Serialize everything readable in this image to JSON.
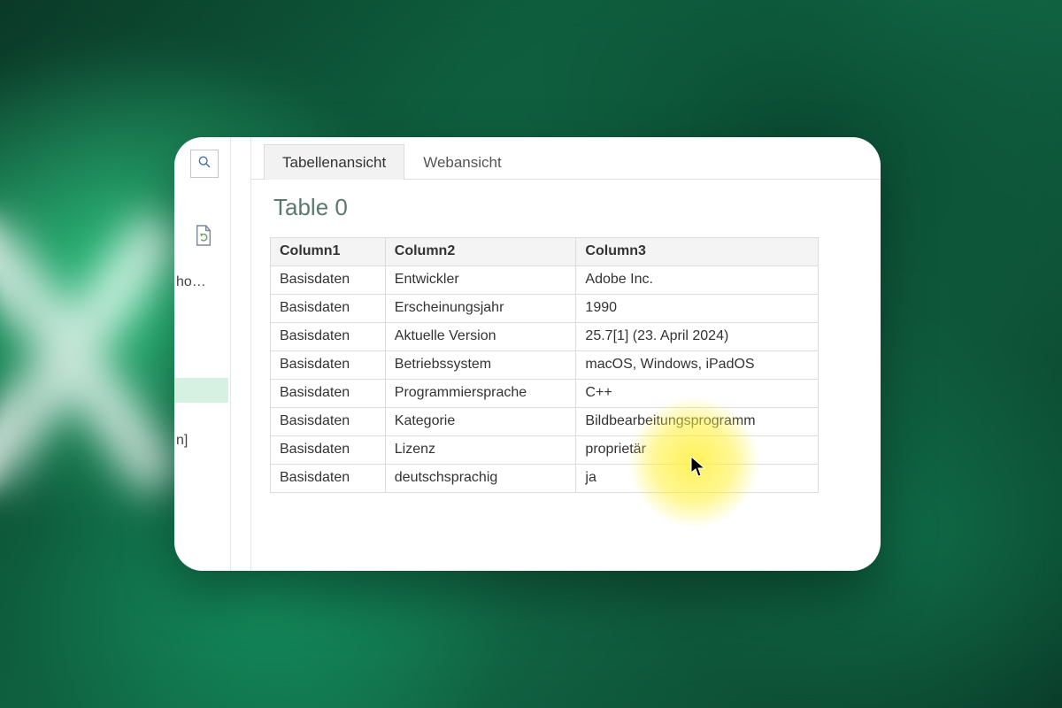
{
  "sidebar": {
    "search_icon_label": "Suchen",
    "text_fragment_1": "ho…",
    "text_fragment_2": "n]"
  },
  "tabs": {
    "table_view": "Tabellenansicht",
    "web_view": "Webansicht"
  },
  "table": {
    "title": "Table 0",
    "headers": {
      "c1": "Column1",
      "c2": "Column2",
      "c3": "Column3"
    },
    "rows": [
      {
        "c1": "Basisdaten",
        "c2": "Entwickler",
        "c3": "Adobe Inc."
      },
      {
        "c1": "Basisdaten",
        "c2": "Erscheinungsjahr",
        "c3": "1990"
      },
      {
        "c1": "Basisdaten",
        "c2": "Aktuelle Version",
        "c3": "25.7[1] (23. April 2024)"
      },
      {
        "c1": "Basisdaten",
        "c2": "Betriebssystem",
        "c3": "macOS, Windows, iPadOS"
      },
      {
        "c1": "Basisdaten",
        "c2": "Programmiersprache",
        "c3": "C++"
      },
      {
        "c1": "Basisdaten",
        "c2": "Kategorie",
        "c3": "Bildbearbeitungsprogramm"
      },
      {
        "c1": "Basisdaten",
        "c2": "Lizenz",
        "c3": "proprietär"
      },
      {
        "c1": "Basisdaten",
        "c2": "deutschsprachig",
        "c3": "ja"
      }
    ]
  }
}
